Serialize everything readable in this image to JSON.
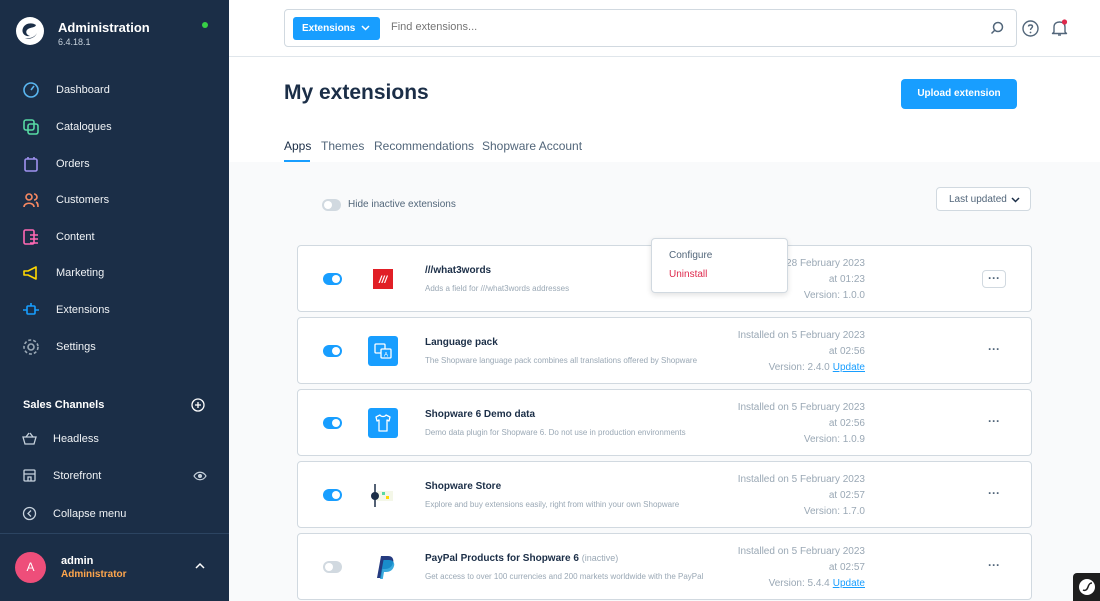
{
  "brand": {
    "title": "Administration",
    "version": "6.4.18.1"
  },
  "nav": [
    {
      "label": "Dashboard",
      "icon": "dashboard-icon",
      "color": "#5ab6f0"
    },
    {
      "label": "Catalogues",
      "icon": "catalogues-icon",
      "color": "#57d9a3"
    },
    {
      "label": "Orders",
      "icon": "orders-icon",
      "color": "#a092f0"
    },
    {
      "label": "Customers",
      "icon": "customers-icon",
      "color": "#f88962"
    },
    {
      "label": "Content",
      "icon": "content-icon",
      "color": "#ff68b4"
    },
    {
      "label": "Marketing",
      "icon": "marketing-icon",
      "color": "#ffd700"
    },
    {
      "label": "Extensions",
      "icon": "extensions-icon",
      "color": "#189eff"
    },
    {
      "label": "Settings",
      "icon": "settings-icon",
      "color": "#9aa8b5"
    }
  ],
  "sales_channels": {
    "title": "Sales Channels",
    "items": [
      {
        "label": "Headless",
        "icon": "basket-icon"
      },
      {
        "label": "Storefront",
        "icon": "storefront-icon"
      }
    ],
    "collapse_label": "Collapse menu"
  },
  "user": {
    "initial": "A",
    "name": "admin",
    "role": "Administrator"
  },
  "search": {
    "type_label": "Extensions",
    "placeholder": "Find extensions..."
  },
  "page": {
    "title": "My extensions",
    "upload_label": "Upload extension"
  },
  "tabs": [
    "Apps",
    "Themes",
    "Recommendations",
    "Shopware Account"
  ],
  "filters": {
    "hide_inactive_label": "Hide inactive extensions",
    "sort_label": "Last updated"
  },
  "extensions": [
    {
      "name": "///what3words",
      "inactive_label": "",
      "description": "Adds a field for ///what3words addresses",
      "installed": "Installed on 28 February 2023",
      "time": "at 01:23",
      "version": "Version: 1.0.0",
      "update_label": "",
      "active": true,
      "logo": "what3words-logo"
    },
    {
      "name": "Language pack",
      "inactive_label": "",
      "description": "The Shopware language pack combines all translations offered by Shopware",
      "installed": "Installed on 5 February 2023",
      "time": "at 02:56",
      "version": "Version: 2.4.0",
      "update_label": "Update",
      "active": true,
      "logo": "language-pack-logo"
    },
    {
      "name": "Shopware 6 Demo data",
      "inactive_label": "",
      "description": "Demo data plugin for Shopware 6. Do not use in production environments",
      "installed": "Installed on 5 February 2023",
      "time": "at 02:56",
      "version": "Version: 1.0.9",
      "update_label": "",
      "active": true,
      "logo": "demo-data-logo"
    },
    {
      "name": "Shopware Store",
      "inactive_label": "",
      "description": "Explore and buy extensions easily, right from within your own Shopware",
      "installed": "Installed on 5 February 2023",
      "time": "at 02:57",
      "version": "Version: 1.7.0",
      "update_label": "",
      "active": true,
      "logo": "shopware-store-logo"
    },
    {
      "name": "PayPal Products for Shopware 6",
      "inactive_label": "(inactive)",
      "description": "Get access to over 100 currencies and 200 markets worldwide with the PayPal",
      "installed": "Installed on 5 February 2023",
      "time": "at 02:57",
      "version": "Version: 5.4.4",
      "update_label": "Update",
      "active": false,
      "logo": "paypal-logo"
    }
  ],
  "context_menu": {
    "configure": "Configure",
    "uninstall": "Uninstall"
  },
  "colors": {
    "sidebar": "#1b2e47",
    "accent": "#189eff",
    "danger": "#de294c",
    "avatar": "#ee4e7a",
    "role": "#ffa64d"
  }
}
